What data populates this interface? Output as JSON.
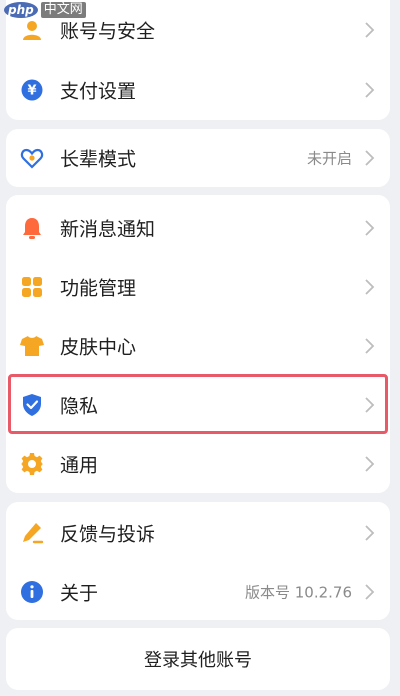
{
  "watermark": {
    "brand": "php",
    "site": "中文网"
  },
  "groups": [
    {
      "items": [
        {
          "label": "账号与安全",
          "icon": "user-icon",
          "value": ""
        },
        {
          "label": "支付设置",
          "icon": "yuan-icon",
          "value": ""
        }
      ]
    },
    {
      "items": [
        {
          "label": "长辈模式",
          "icon": "heart-icon",
          "value": "未开启"
        }
      ]
    },
    {
      "items": [
        {
          "label": "新消息通知",
          "icon": "bell-icon",
          "value": ""
        },
        {
          "label": "功能管理",
          "icon": "grid-icon",
          "value": ""
        },
        {
          "label": "皮肤中心",
          "icon": "shirt-icon",
          "value": ""
        },
        {
          "label": "隐私",
          "icon": "shield-icon",
          "value": ""
        },
        {
          "label": "通用",
          "icon": "gear-icon",
          "value": ""
        }
      ]
    },
    {
      "items": [
        {
          "label": "反馈与投诉",
          "icon": "pen-icon",
          "value": ""
        },
        {
          "label": "关于",
          "icon": "info-icon",
          "value": "版本号 10.2.76"
        }
      ]
    }
  ],
  "login_other_label": "登录其他账号",
  "colors": {
    "orange": "#f5a623",
    "blue": "#2f6fe0",
    "highlight": "#e85a67"
  }
}
